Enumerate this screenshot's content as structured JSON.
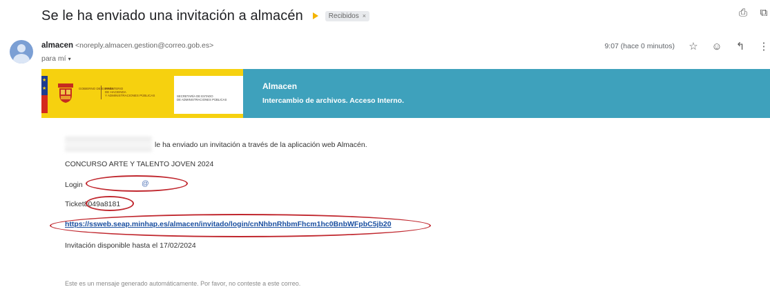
{
  "email": {
    "subject": "Se le ha enviado una invitación a almacén",
    "label_chip": "Recibidos",
    "label_chip_close": "×",
    "sender_name": "almacen",
    "sender_email": "<noreply.almacen.gestion@correo.gob.es>",
    "recipient": "para mí",
    "recipient_caret": "▾",
    "time": "9:07 (hace 0 minutos)",
    "icons": {
      "print": "print-icon",
      "open_new": "open-in-new-icon",
      "star": "star-icon",
      "emoji": "emoji-icon",
      "reply": "reply-icon",
      "more": "more-icon"
    }
  },
  "banner": {
    "gobierno": "Gobierno de España",
    "ministerio_1": "Ministerio",
    "ministerio_2": "de Hacienda",
    "ministerio_3": "y Administraciones Públicas",
    "secretaria_1": "Secretaría de Estado",
    "secretaria_2": "de Administraciones Públicas",
    "title": "Almacen",
    "subtitle": "Intercambio de archivos. Acceso Interno."
  },
  "body": {
    "line1": "le ha enviado un invitación a través de la aplicación web Almacén.",
    "line2": "CONCURSO ARTE Y TALENTO JOVEN 2024",
    "login_label": "Login",
    "login_mark": "@",
    "ticket_label": "Ticket",
    "ticket_value": "8049a8181",
    "link": "https://ssweb.seap.minhap.es/almacen/invitado/login/cnNhbnRhbmFhcm1hc0BnbWFpbC5jb20",
    "availability": "Invitación disponible hasta el 17/02/2024",
    "footer": "Este es un mensaje generado automáticamente. Por favor, no conteste a este correo."
  },
  "colors": {
    "banner_blue": "#3ea1bc",
    "banner_yellow": "#f6d10f",
    "annotation_red": "#c0262d",
    "link_blue": "#1a4fa0"
  }
}
